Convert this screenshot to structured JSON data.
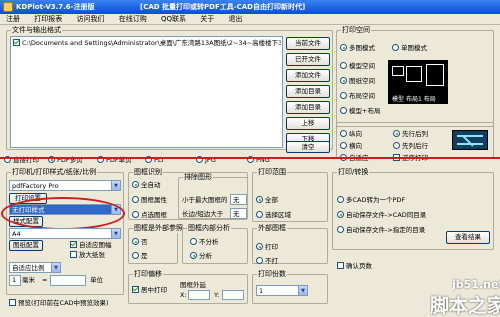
{
  "titlebar": {
    "left": "KDPlot-V3.7.6-注册版",
    "center": "[CAD 批量打印或转PDF工具-CAD自由打印新时代]"
  },
  "menu": [
    "注册",
    "打印报表",
    "访问我们",
    "在线订购",
    "QQ联系",
    "关于",
    "退出"
  ],
  "files": {
    "label": "文件与输出格式",
    "path": "C:\\Documents and Settings\\Administrator\\桌面\\广东湾路13A图纸\\2~34~高楼楼下3.dwg",
    "buttons": [
      "当前文件",
      "已开文件",
      "添加文件",
      "添加目录",
      "添加目录",
      "上移",
      "下移",
      "清空"
    ]
  },
  "print_space": {
    "label": "打印空间",
    "options": [
      "多图模式",
      "单图模式",
      "模型空间",
      "图纸空间",
      "布局空间",
      "模型+布局"
    ],
    "selected": 0,
    "selected2": 1,
    "preview": [
      "模型",
      "布局1",
      "布局"
    ]
  },
  "order": {
    "options": [
      "纵向",
      "横向",
      "自适应"
    ],
    "selected": 2,
    "options2": [
      "先行后列",
      "先列后行"
    ],
    "selected2": 0,
    "reverse": "逆序打印"
  },
  "formats": [
    "直接打印",
    "PDF多页",
    "PDF单页",
    "PLT",
    "JPG",
    "PNG"
  ],
  "formats_selected": 1,
  "printer": {
    "label": "打印机/打印样式/纸张/比例",
    "device": "pdfFactory Pro",
    "settings_btn": "打印设置",
    "style": "无打印样式",
    "style_btn": "样式配置",
    "paper": "A4",
    "paper_btn": "图纸配置",
    "auto_rotate": "自适应图幅",
    "enlarge": "放大纸张",
    "scale_label": "自适应比例",
    "scale_value": "1",
    "unit_mm": "毫米",
    "equal": "=",
    "unit_label": "单位"
  },
  "frame": {
    "label": "图框识别",
    "options": [
      "全自动",
      "图框属性",
      "点选图框"
    ],
    "selected": 0,
    "exclude": {
      "label": "排除图形",
      "less": "小于最大图框的",
      "less_value": "无",
      "ratio": "长边/短边大于",
      "ratio_value": "无"
    },
    "ref": {
      "label": "图框是外部参照",
      "options": [
        "否",
        "是"
      ],
      "selected": 0
    },
    "inner": {
      "label": "图框内部分析",
      "options": [
        "不分析",
        "分析"
      ],
      "selected": 1
    }
  },
  "offset": {
    "label": "打印偏移",
    "center": "居中打印",
    "x_label": "X:",
    "y_label": "Y:",
    "extend": "图框外延",
    "x_value": "",
    "y_value": ""
  },
  "range": {
    "label": "打印范围",
    "options": [
      "全部",
      "选择区域"
    ],
    "selected": 0
  },
  "frame_type": {
    "label": "外部图框",
    "options": [
      "打印",
      "不打"
    ],
    "selected": 0
  },
  "copies": {
    "label": "打印份数",
    "value": "1"
  },
  "convert": {
    "label": "打印/转换",
    "options": [
      "多CAD转为一个PDF",
      "自动保存文件->CAD同目录",
      "自动保存文件->指定的目录"
    ],
    "selected": 1,
    "view_btn": "查看结果",
    "confirm": "确认页数"
  },
  "preview": {
    "label": "预览(打印前在CAD中预览效果)"
  },
  "watermark": {
    "top": "jb51.net",
    "bottom": "脚本之家"
  }
}
